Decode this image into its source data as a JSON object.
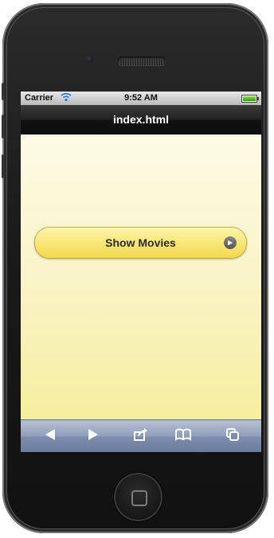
{
  "device": "iPhone",
  "statusbar": {
    "carrier": "Carrier",
    "time": "9:52 AM"
  },
  "navbar": {
    "title": "index.html"
  },
  "content": {
    "button_label": "Show Movies"
  },
  "colors": {
    "content_bg_top": "#fdfbe6",
    "content_bg_bottom": "#f6ee9f",
    "button_fill": "#f8e778",
    "toolbar": "#8f9dba",
    "navbar": "#222222"
  },
  "toolbar": {
    "icons": [
      "back-arrow-icon",
      "forward-arrow-icon",
      "share-icon",
      "bookmarks-icon",
      "pages-icon"
    ]
  }
}
